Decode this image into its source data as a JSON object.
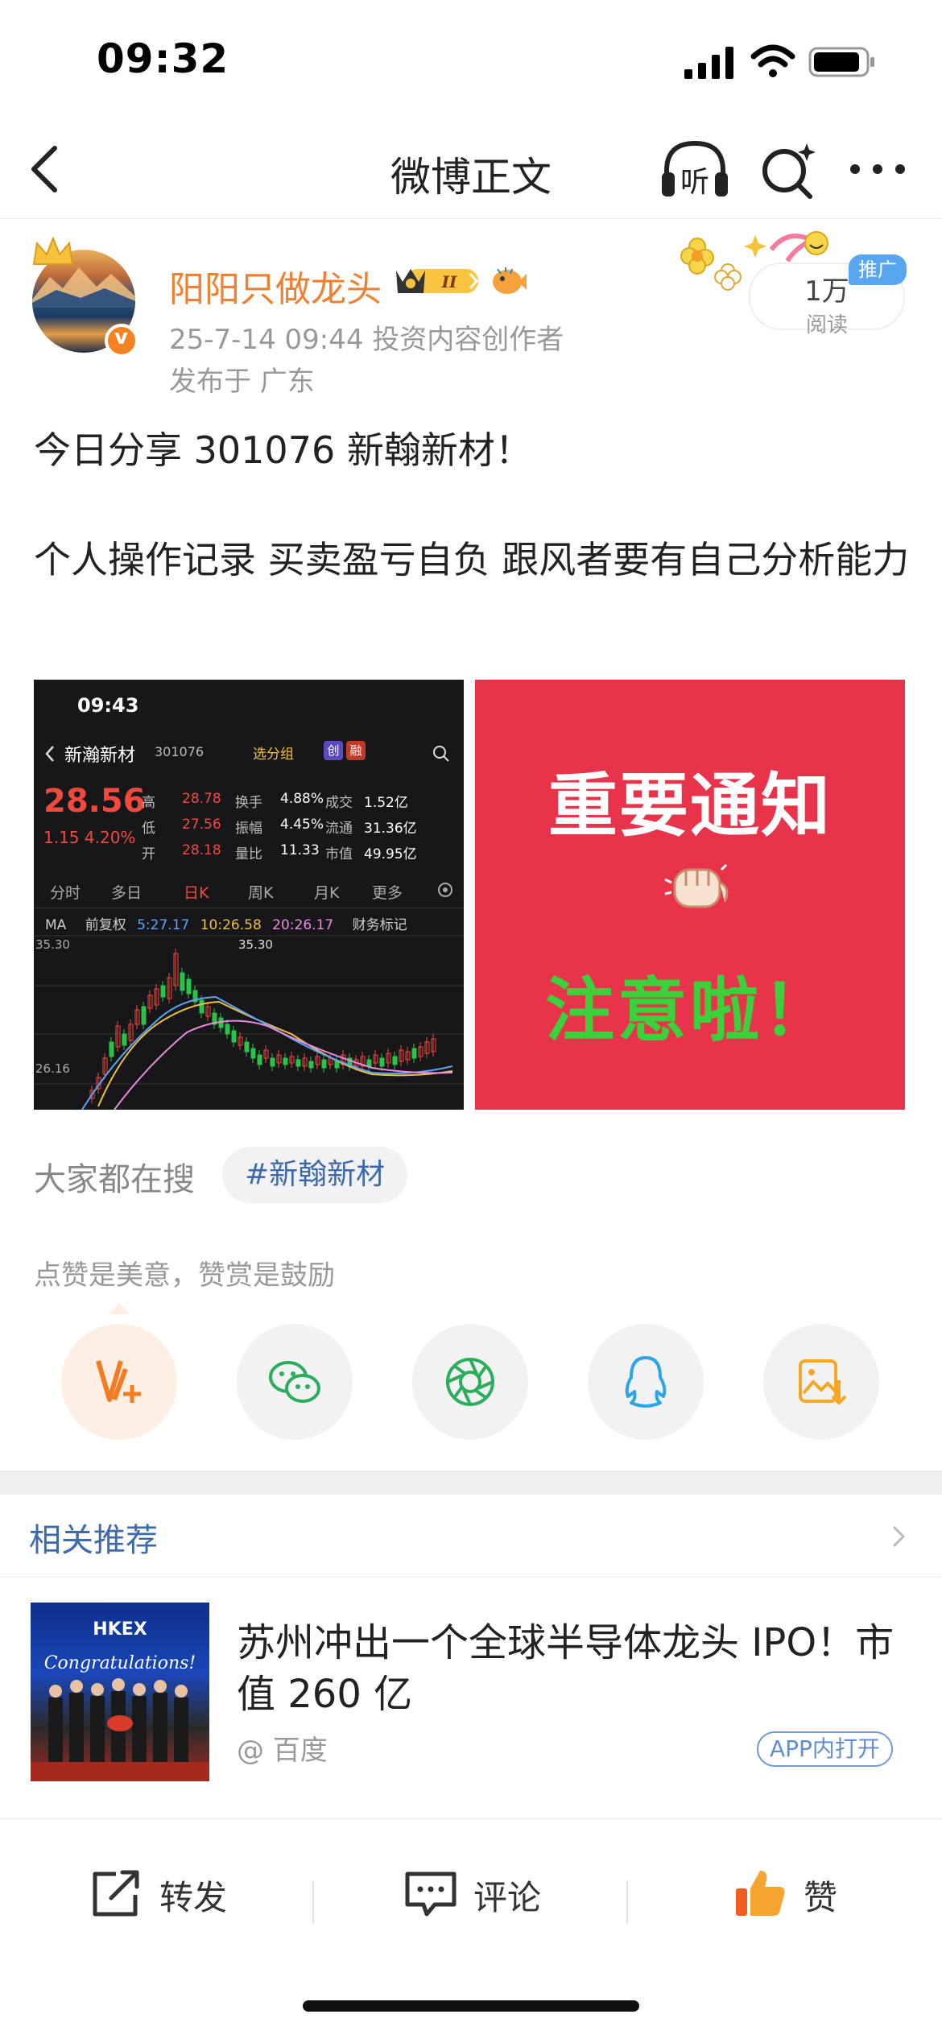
{
  "status_bar": {
    "time": "09:32"
  },
  "nav": {
    "title": "微博正文",
    "listen_label": "听"
  },
  "author": {
    "name": "阳阳只做龙头",
    "badge_level": "II",
    "post_meta": "25-7-14 09:44  投资内容创作者",
    "location": "发布于 广东",
    "read_count": "1万",
    "read_label": "阅读",
    "promo_tag": "推广"
  },
  "post": {
    "line1": "今日分享 301076 新翰新材！",
    "line2": "个人操作记录 买卖盈亏自负 跟风者要有自己分析能力"
  },
  "stock_image": {
    "time": "09:43",
    "name": "新瀚新材",
    "code": "301076",
    "group_btn": "选分组",
    "tag1": "创",
    "tag2": "融",
    "price": "28.56",
    "change": "1.15  4.20%",
    "rows": [
      [
        "高",
        "28.78",
        "换手",
        "4.88%",
        "成交",
        "1.52亿"
      ],
      [
        "低",
        "27.56",
        "振幅",
        "4.45%",
        "流通",
        "31.36亿"
      ],
      [
        "开",
        "28.18",
        "量比",
        "11.33",
        "市值",
        "49.95亿"
      ]
    ],
    "tabs": [
      "分时",
      "多日",
      "日K",
      "周K",
      "月K",
      "更多"
    ],
    "ma_label": "MA",
    "ma_adj": "前复权",
    "ma5": "5:27.17",
    "ma10": "10:26.58",
    "ma20": "20:26.17",
    "finance_tag": "财务标记",
    "price_high_axis": "35.30",
    "price_low_axis": "26.16",
    "peak_label": "35.30"
  },
  "notice_image": {
    "title": "重要通知",
    "subtitle": "注意啦！"
  },
  "search": {
    "label": "大家都在搜",
    "tag": "#新翰新材"
  },
  "share": {
    "hint": "点赞是美意，赞赏是鼓励",
    "buttons": [
      "reward-icon",
      "wechat-icon",
      "moments-icon",
      "qq-icon",
      "save-image-icon"
    ]
  },
  "related": {
    "title": "相关推荐",
    "headline": "苏州冲出一个全球半导体龙头 IPO！市值 260 亿",
    "source": "@ 百度",
    "app_open": "APP内打开",
    "thumb_text": "Congratulations!",
    "thumb_brand": "HKEX"
  },
  "bottom_bar": {
    "repost": "转发",
    "comment": "评论",
    "like": "赞"
  },
  "colors": {
    "accent_orange": "#f08030",
    "link_blue": "#3d6aa8",
    "stock_red": "#f14a3c",
    "notice_red": "#e8344a",
    "notice_green": "#3ad13a"
  }
}
